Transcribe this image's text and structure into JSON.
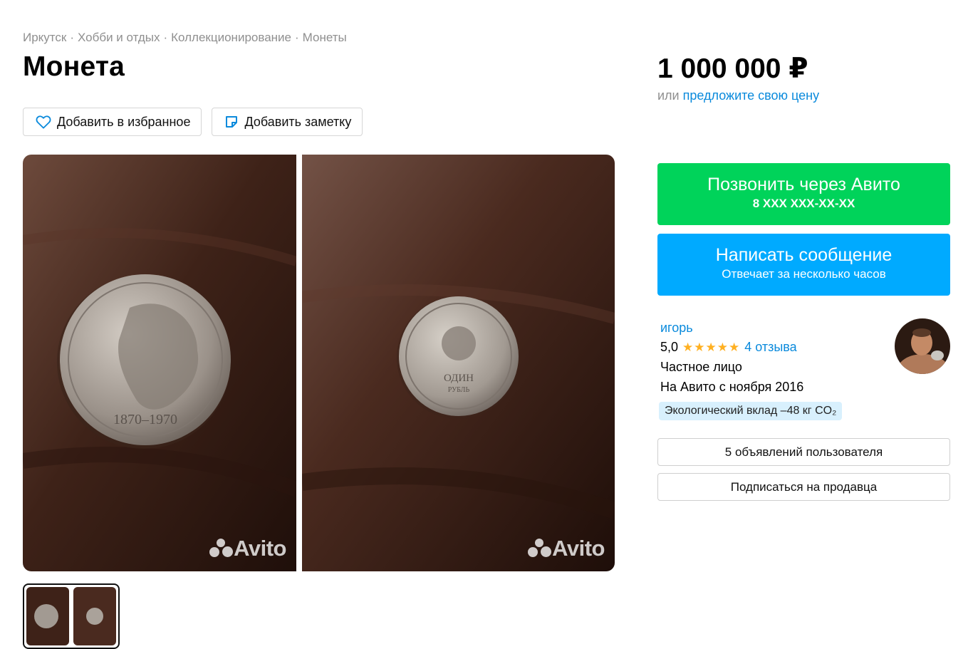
{
  "breadcrumb": {
    "items": [
      "Иркутск",
      "Хобби и отдых",
      "Коллекционирование",
      "Монеты"
    ],
    "separator": "·"
  },
  "listing": {
    "title": "Монета",
    "price": "1 000 000 ₽",
    "offer_prefix": "или",
    "offer_link": "предложите свою цену"
  },
  "actions": {
    "favorite_label": "Добавить в избранное",
    "note_label": "Добавить заметку"
  },
  "gallery": {
    "watermark": "Avito",
    "photo_count": 2
  },
  "contact": {
    "call_title": "Позвонить через Авито",
    "call_phone": "8 XXX XXX-XX-XX",
    "message_title": "Написать сообщение",
    "message_subtitle": "Отвечает за несколько часов"
  },
  "seller": {
    "name": "игорь",
    "rating": "5,0",
    "stars": "★★★★★",
    "reviews": "4 отзыва",
    "type": "Частное лицо",
    "since": "На Авито с ноября 2016",
    "eco_badge": "Экологический вклад –48 кг CO₂",
    "ads_button": "5 объявлений пользователя",
    "subscribe_button": "Подписаться на продавца"
  },
  "colors": {
    "call_button": "#00d35a",
    "message_button": "#00aaff",
    "link": "#0a8adc",
    "stars": "#ffb021",
    "eco_badge_bg": "#d8f0fd"
  }
}
